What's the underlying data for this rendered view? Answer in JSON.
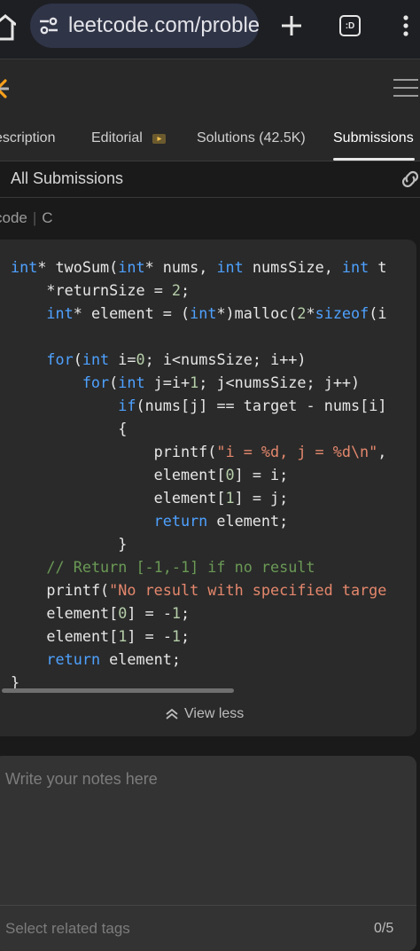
{
  "browser": {
    "url": "leetcode.com/problem",
    "tabs_label": ":D"
  },
  "tabs": {
    "description": "escription",
    "editorial": "Editorial",
    "solutions": "Solutions (42.5K)",
    "submissions": "Submissions"
  },
  "section": {
    "title": "All Submissions"
  },
  "lang": {
    "label": "code",
    "value": "C"
  },
  "code": {
    "lines": [
      "int* twoSum(int* nums, int numsSize, int t",
      "    *returnSize = 2;",
      "    int* element = (int*)malloc(2*sizeof(i",
      "",
      "    for(int i=0; i<numsSize; i++)",
      "        for(int j=i+1; j<numsSize; j++)",
      "            if(nums[j] == target - nums[i]",
      "            {",
      "                printf(\"i = %d, j = %d\\n\",",
      "                element[0] = i;",
      "                element[1] = j;",
      "                return element;",
      "            }",
      "    // Return [-1,-1] if no result",
      "    printf(\"No result with specified targe",
      "    element[0] = -1;",
      "    element[1] = -1;",
      "    return element;",
      "}"
    ]
  },
  "actions": {
    "view_less": "View less"
  },
  "notes": {
    "placeholder": "Write your notes here",
    "tags_placeholder": "Select related tags",
    "counter": "0/5"
  },
  "colors": {
    "keyword": "#4ea1ff",
    "string": "#e4876c",
    "comment": "#6a9955"
  }
}
